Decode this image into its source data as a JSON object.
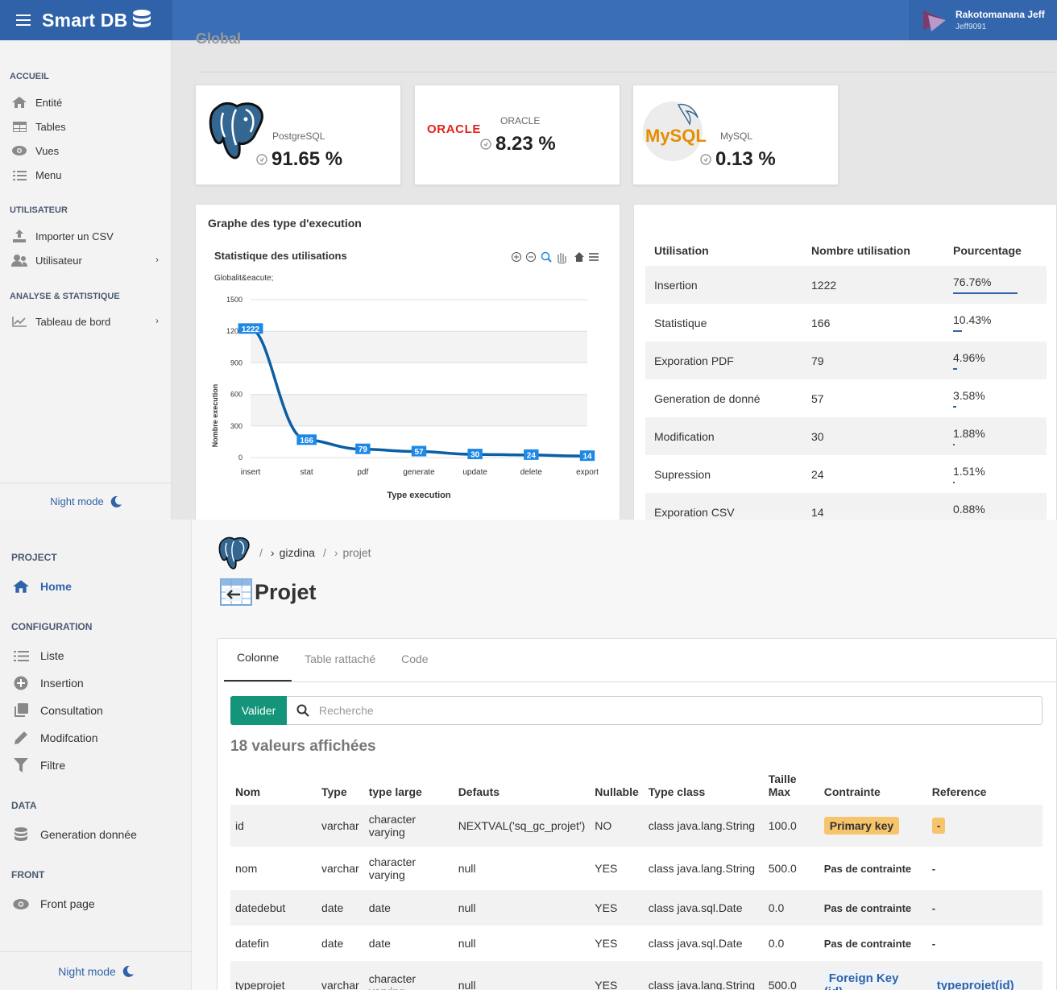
{
  "header": {
    "app_name": "Smart DB",
    "user_name": "Rakotomanana Jeff",
    "user_login": "Jeff9091"
  },
  "sidebar_top": {
    "sections": [
      {
        "title": "ACCUEIL",
        "items": [
          {
            "label": "Entité",
            "icon": "home-icon"
          },
          {
            "label": "Tables",
            "icon": "table-icon"
          },
          {
            "label": "Vues",
            "icon": "eye-icon"
          },
          {
            "label": "Menu",
            "icon": "list-check-icon"
          }
        ]
      },
      {
        "title": "UTILISATEUR",
        "items": [
          {
            "label": "Importer un CSV",
            "icon": "upload-icon"
          },
          {
            "label": "Utilisateur",
            "icon": "users-icon"
          }
        ]
      },
      {
        "title": "ANALYSE & STATISTIQUE",
        "items": [
          {
            "label": "Tableau de bord",
            "icon": "line-chart-icon"
          }
        ]
      }
    ],
    "night_mode": "Night mode"
  },
  "dashboard": {
    "section_title": "Global",
    "databases": [
      {
        "name": "PostgreSQL",
        "percent": "91.65 %"
      },
      {
        "name": "ORACLE",
        "percent": "8.23 %",
        "logo_text": "ORACLE"
      },
      {
        "name": "MySQL",
        "percent": "0.13 %",
        "logo_text": "MySQL"
      }
    ],
    "chart_card_title": "Graphe des type d'execution",
    "usage_table": {
      "headers": [
        "Utilisation",
        "Nombre utilisation",
        "Pourcentage"
      ],
      "rows": [
        [
          "Insertion",
          "1222",
          "76.76%"
        ],
        [
          "Statistique",
          "166",
          "10.43%"
        ],
        [
          "Exporation PDF",
          "79",
          "4.96%"
        ],
        [
          "Generation de donné",
          "57",
          "3.58%"
        ],
        [
          "Modification",
          "30",
          "1.88%"
        ],
        [
          "Supression",
          "24",
          "1.51%"
        ],
        [
          "Exporation CSV",
          "14",
          "0.88%"
        ]
      ]
    }
  },
  "chart_data": {
    "type": "line",
    "title": "Statistique des utilisations",
    "subtitle": "Globalit&eacute;",
    "xlabel": "Type execution",
    "ylabel": "Nombre execution",
    "categories": [
      "insert",
      "stat",
      "pdf",
      "generate",
      "update",
      "delete",
      "export"
    ],
    "series": [
      {
        "values": [
          1222,
          166,
          79,
          57,
          30,
          24,
          14
        ]
      }
    ],
    "ylim": [
      0,
      1500
    ],
    "yticks": [
      "0",
      "300",
      "600",
      "900",
      "1200",
      "1500"
    ],
    "grid": true,
    "color": "#0b5fa5"
  },
  "sidebar_bottom": {
    "sections": [
      {
        "title": "PROJECT",
        "items": [
          {
            "label": "Home",
            "icon": "home-icon",
            "active": true
          }
        ]
      },
      {
        "title": "CONFIGURATION",
        "items": [
          {
            "label": "Liste",
            "icon": "list-icon"
          },
          {
            "label": "Insertion",
            "icon": "plus-circle-icon"
          },
          {
            "label": "Consultation",
            "icon": "copy-icon"
          },
          {
            "label": "Modifcation",
            "icon": "pencil-icon"
          },
          {
            "label": "Filtre",
            "icon": "filter-icon"
          }
        ]
      },
      {
        "title": "DATA",
        "items": [
          {
            "label": "Generation donnée",
            "icon": "database-icon"
          }
        ]
      },
      {
        "title": "FRONT",
        "items": [
          {
            "label": "Front page",
            "icon": "eye-icon"
          }
        ]
      }
    ],
    "night_mode": "Night mode"
  },
  "project": {
    "breadcrumb": [
      "/",
      "gizdina",
      "/",
      "projet"
    ],
    "title": "Projet",
    "tabs": [
      "Colonne",
      "Table rattaché",
      "Code"
    ],
    "valider_label": "Valider",
    "search_placeholder": "Recherche",
    "count_label": "18 valeurs affichées",
    "columns_headers": [
      "Nom",
      "Type",
      "type large",
      "Defauts",
      "Nullable",
      "Type class",
      "Taille Max",
      "Contrainte",
      "Reference"
    ],
    "rows": [
      {
        "nom": "id",
        "type": "varchar",
        "large": "character varying",
        "defaut": "NEXTVAL('sq_gc_projet')",
        "nullable": "NO",
        "class": "class java.lang.String",
        "taille": "100.0",
        "contrainte": "Primary key",
        "reference": "-"
      },
      {
        "nom": "nom",
        "type": "varchar",
        "large": "character varying",
        "defaut": "null",
        "nullable": "YES",
        "class": "class java.lang.String",
        "taille": "500.0",
        "contrainte": "Pas de contrainte",
        "reference": "-"
      },
      {
        "nom": "datedebut",
        "type": "date",
        "large": "date",
        "defaut": "null",
        "nullable": "YES",
        "class": "class java.sql.Date",
        "taille": "0.0",
        "contrainte": "Pas de contrainte",
        "reference": "-"
      },
      {
        "nom": "datefin",
        "type": "date",
        "large": "date",
        "defaut": "null",
        "nullable": "YES",
        "class": "class java.sql.Date",
        "taille": "0.0",
        "contrainte": "Pas de contrainte",
        "reference": "-"
      },
      {
        "nom": "typeprojet",
        "type": "varchar",
        "large": "character varying",
        "defaut": "null",
        "nullable": "YES",
        "class": "class java.lang.String",
        "taille": "500.0",
        "contrainte": "Foreign Key (id)",
        "reference": "typeprojet(id)"
      }
    ]
  }
}
